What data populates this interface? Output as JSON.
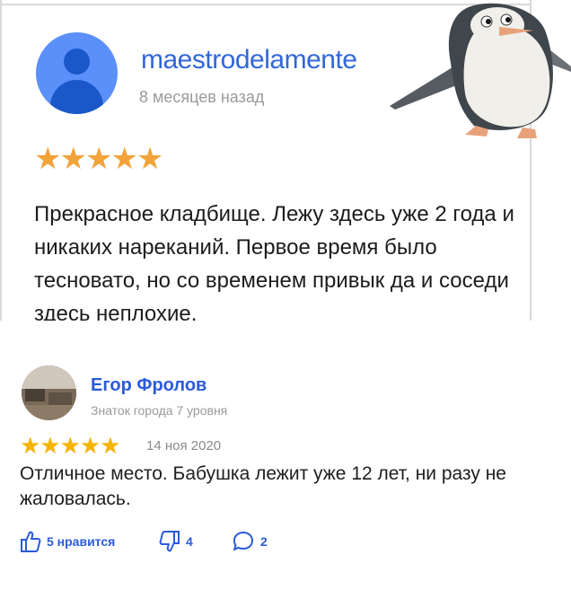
{
  "review_google": {
    "author": "maestrodelamente",
    "time": "8 месяцев назад",
    "stars": "★★★★★",
    "rating": 5,
    "text": "Прекрасное кладбище. Лежу здесь уже 2 года и никаких нареканий. Первое время было тесновато, но со временем привык да и соседи здесь неплохие.",
    "star_color": "#f2a33a",
    "name_color": "#3167d8"
  },
  "review_yandex": {
    "author": "Егор Фролов",
    "level": "Знаток города 7 уровня",
    "stars": "★★★★★",
    "rating": 5,
    "date": "14 ноя 2020",
    "text": "Отличное место. Бабушка лежит уже 12 лет, ни разу не жаловалась.",
    "likes_label": "5 нравится",
    "dislikes": "4",
    "comments": "2",
    "accent": "#2b5bd8"
  },
  "icons": {
    "like": "thumbs-up-icon",
    "dislike": "thumbs-down-icon",
    "comment": "comment-bubble-icon",
    "avatar_placeholder": "person-icon"
  }
}
